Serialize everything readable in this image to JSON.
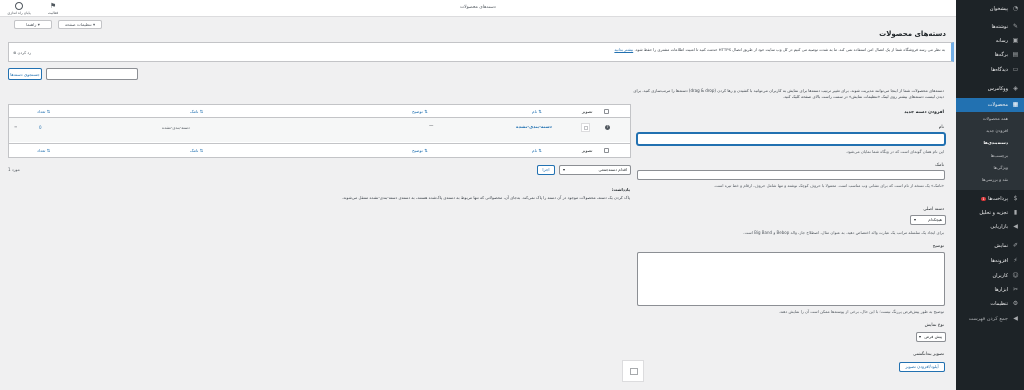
{
  "topbar": {
    "screen_options": "تنظیمات صفحه",
    "help": "راهنما",
    "activity": "فعالیت",
    "finish_setup": "پایان راه اندازی",
    "page_tab": "دسته‌های محصولات"
  },
  "page": {
    "title": "دسته‌های محصولات"
  },
  "notice": {
    "text": "به نظر می رسد فروشگاه شما از یک اتصال امن استفاده نمی کند. ما به شدت توصیه می کنیم در کل وب سایت خود از طریق اتصال HTTPS خدمت کنید تا امنیت اطلاعات مشتری را حفظ شود.",
    "link": "بیشتر بدانید",
    "dismiss": "رد کردن"
  },
  "search": {
    "button": "جستجوی دسته‌ها",
    "placeholder": ""
  },
  "intro": {
    "line1": "دسته‌های محصولات شما از اینجا می‌توانند مدیریت شوند. برای تغییر ترتیب دسته‌ها برای نمایش به کاربران می‌توانید با کشیدن و رها کردن (drag & drop) دسته‌ها را مرتب‌سازی کنید. برای دیدن لیست دسته‌های بیشتر روی لینک «تنظیمات نمایش» در سمت راست بالای صفحه کلیک کنید."
  },
  "add_form": {
    "heading": "افزودن دسته جدید",
    "name_label": "نام",
    "name_hint": "این نام همان گونه‌ای است که در وبگاه شما نمایان می‌شود.",
    "slug_label": "نامک",
    "slug_hint": "«نامک» یک نسخه از نام است که برای نشانی وب مناسب است. معمولا با حروف کوچک نوشته و تنها شامل حروف، ارقام و خط تیره است.",
    "parent_label": "دسته اصلی",
    "parent_value": "هیچکدام",
    "parent_hint": "برای ایجاد یک سلسله مراتب یک عبارت والد اختصاص دهید. به عنوان مثال، اصطلاح جاز، والد Bebop و Big Band است.",
    "desc_label": "توضیح",
    "desc_hint": "توضیح به طور پیش‌فرض پررنگ نیست؛ با این حال، برخی از پوسته‌ها ممکن است آن را نمایش دهند.",
    "display_label": "نوع نمایش",
    "display_value": "پیش فرض",
    "thumb_label": "تصویر بندانگشتی",
    "thumb_button": "آپلود/افزودن تصویر"
  },
  "bulk": {
    "action": "اقدام دسته‌جمعی",
    "apply": "اجرا",
    "count": "1 مورد"
  },
  "table": {
    "headers": {
      "image": "تصویر",
      "name": "نام",
      "description": "توضیح",
      "slug": "نامک",
      "count": "تعداد"
    },
    "rows": [
      {
        "name": "دسته-بندی-نشده",
        "description": "—",
        "slug": "دسته-بندی-نشده",
        "count": "0"
      }
    ]
  },
  "note": {
    "title": "یادداشت:",
    "text": "پاک کردن یک دسته، محصولات موجود در آن دسته را پاک نمی‌کند. به‌جای آن، محصولاتی که تنها مربوط به دسته‌ی پاک‌شده هستند، به دسته‌ی دسته-بندی-نشده منتقل می‌شوند."
  },
  "sidebar": {
    "items": [
      {
        "label": "پیشخوان",
        "icon": "dashboard-icon"
      },
      {
        "label": "نوشته‌ها",
        "icon": "pin-icon"
      },
      {
        "label": "رسانه",
        "icon": "media-icon"
      },
      {
        "label": "برگه‌ها",
        "icon": "page-icon"
      },
      {
        "label": "دیدگاه‌ها",
        "icon": "comment-icon"
      },
      {
        "label": "ووکامرس",
        "icon": "woo-icon"
      },
      {
        "label": "محصولات",
        "icon": "product-icon"
      },
      {
        "label": "پرداخت‌ها",
        "icon": "payment-icon",
        "badge": "1"
      },
      {
        "label": "تجزیه و تحلیل",
        "icon": "chart-icon"
      },
      {
        "label": "بازاریابی",
        "icon": "megaphone-icon"
      },
      {
        "label": "نمایش",
        "icon": "brush-icon"
      },
      {
        "label": "افزونه‌ها",
        "icon": "plugin-icon"
      },
      {
        "label": "کاربران",
        "icon": "users-icon"
      },
      {
        "label": "ابزارها",
        "icon": "tools-icon"
      },
      {
        "label": "تنظیمات",
        "icon": "settings-icon"
      },
      {
        "label": "جمع کردن فهرست",
        "icon": "collapse-icon"
      }
    ],
    "sub": [
      "همه محصولات",
      "افزودن جدید",
      "دسته‌بندی‌ها",
      "برچسب‌ها",
      "ویژگی‌ها",
      "نقد و بررسی‌ها"
    ]
  },
  "colors": {
    "sidebar_bg": "#1d2327",
    "accent": "#2271b1",
    "notice_border": "#72aee6"
  }
}
